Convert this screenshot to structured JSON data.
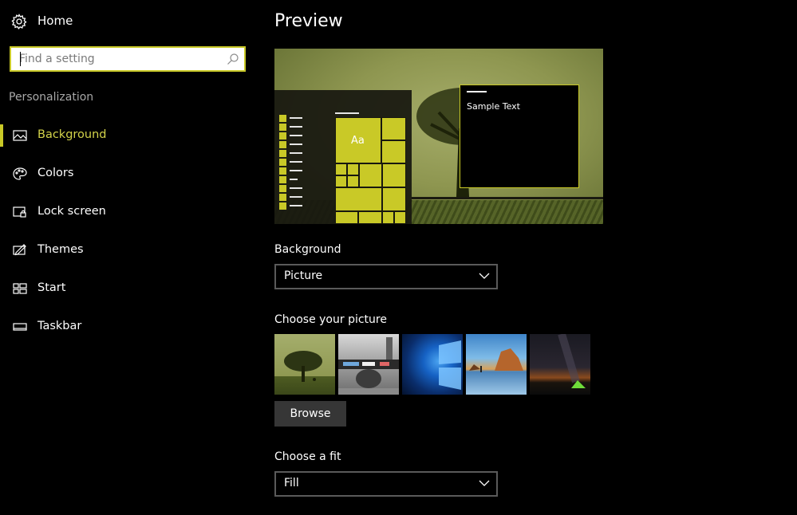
{
  "sidebar": {
    "home_label": "Home",
    "search_placeholder": "Find a setting",
    "section_title": "Personalization",
    "items": [
      {
        "label": "Background",
        "icon": "picture-icon",
        "active": true
      },
      {
        "label": "Colors",
        "icon": "palette-icon",
        "active": false
      },
      {
        "label": "Lock screen",
        "icon": "lock-screen-icon",
        "active": false
      },
      {
        "label": "Themes",
        "icon": "themes-icon",
        "active": false
      },
      {
        "label": "Start",
        "icon": "start-icon",
        "active": false
      },
      {
        "label": "Taskbar",
        "icon": "taskbar-icon",
        "active": false
      }
    ]
  },
  "main": {
    "preview_title": "Preview",
    "preview_tile_text": "Aa",
    "preview_window_text": "Sample Text",
    "background_label": "Background",
    "background_value": "Picture",
    "choose_picture_label": "Choose your picture",
    "thumbnails": [
      {
        "name": "tree-on-green"
      },
      {
        "name": "city-billboard"
      },
      {
        "name": "windows-10-hero"
      },
      {
        "name": "beach-rocks"
      },
      {
        "name": "night-sky-tent"
      }
    ],
    "browse_label": "Browse",
    "fit_label": "Choose a fit",
    "fit_value": "Fill"
  },
  "colors": {
    "accent": "#c9c927",
    "background": "#000000",
    "secondary_text": "#a8a8a8",
    "button_bg": "#363636"
  }
}
